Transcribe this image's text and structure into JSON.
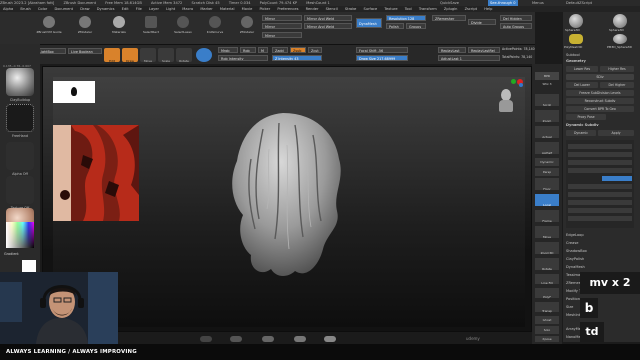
{
  "titlebar": {
    "items": [
      "ZBrush 2023.2 [Abraham fatt]",
      "ZBrush Document",
      "Free Mem 18.614GB",
      "Active Mem 3472",
      "Scratch Disk 45",
      "Timer 0.034",
      "PolyCount 79.474 KP",
      "MeshCount 1"
    ],
    "quicksave": "QuickSave",
    "seethrough": "See-through 0",
    "menus_label": "Menus",
    "script": "DefaultZScript"
  },
  "menubar": {
    "items": [
      "Alpha",
      "Brush",
      "Color",
      "Document",
      "Draw",
      "Dynamics",
      "Edit",
      "File",
      "Layer",
      "Light",
      "Macro",
      "Marker",
      "Material",
      "Movie",
      "Picker",
      "Preferences",
      "Render",
      "Stencil",
      "Stroke",
      "Surface",
      "Texture",
      "Tool",
      "Transform",
      "Zplugin",
      "Zscript",
      "Help"
    ]
  },
  "shelf": {
    "buttons": [
      "ZBrushVM Guide",
      "ZModeler",
      "Materials",
      "SelectRect",
      "SelectLasso",
      "KnifeCurve",
      "ZModeler"
    ],
    "mirror_label": "Mirror",
    "mirror_weld_label": "Mirror And Weld",
    "dynamesh_label": "DynaMesh",
    "resolution_label": "Resolution 128",
    "polish_label": "Polish",
    "groups_label": "Groups",
    "zremesh_label": "ZRemesher",
    "divide_label": "Divide",
    "del_hidden_label": "Del Hidden",
    "auto_groups_label": "Auto Groups",
    "edit_label": "Edit",
    "draw_label": "Draw",
    "move_label": "Move",
    "scale_label": "Scale",
    "rotate_label": "Rotate",
    "mrgb_label": "Mrgb",
    "rgb_label": "Rgb",
    "m_label": "M",
    "zadd_label": "Zadd",
    "zsub_label": "Zsub",
    "zcut_label": "Zcut",
    "focal_label": "Focal Shift -56",
    "draw_size_label": "Draw Size 217.68999",
    "z_intensity_label": "Z Intensity 43",
    "rgb_intensity_label": "Rgb Intensity",
    "replay_last": "ReplayLast",
    "replay_last_rel": "ReplayLastRel",
    "active_points": "ActivePoints: 78,140",
    "total_points": "TotalPoints: 78,140",
    "adjust_last": "AdjustLast 1",
    "left_buttons": [
      "Home Page",
      "LightBox",
      "Live Boolean"
    ]
  },
  "left_panel": {
    "brush_label": "ClayBuildup",
    "stroke_label": "FreeHand",
    "alpha_label": "Alpha Off",
    "texture_label": "Texture Off",
    "material_label": "SkinSphMaterial",
    "gradient_label": "Gradient",
    "coords_label": "0.135,-0.76,-0.607"
  },
  "right_strip": {
    "items": [
      "BPR",
      "SPix 3",
      "Scroll",
      "Zoom",
      "Actual",
      "AAHalf",
      "Dynamic",
      "Persp",
      "Floor",
      "Local",
      "Frame",
      "Move",
      "Zoom3D",
      "Rotate",
      "Line Fill",
      "PolyF",
      "Transp",
      "Ghost",
      "Solo",
      "Xpose"
    ]
  },
  "right_panel": {
    "tool_thumbs": [
      "Sphere3D",
      "PolyMesh3D",
      "Sphere3D",
      "PM3D_Sphere3D"
    ],
    "subtool_label": "Subtool",
    "geometry_label": "Geometry",
    "lower_res": "Lower Res",
    "higher_res": "Higher Res",
    "sdiv_label": "SDiv",
    "del_lower": "Del Lower",
    "del_higher": "Del Higher",
    "freeze_label": "Freeze SubDivision Levels",
    "reconstruct": "Reconstruct Subdiv",
    "convert_bpr": "Convert BPR To Geo",
    "proxy_pose": "Proxy Pose",
    "dynamic_subdiv": "Dynamic Subdiv",
    "dynamic_label": "Dynamic",
    "apply_label": "Apply",
    "items": [
      "EdgeLoop",
      "Crease",
      "ShadowBox",
      "ClayPolish",
      "DynaMesh",
      "Tessimate",
      "ZRemesher",
      "Modify Topology",
      "Position",
      "Size",
      "MeshIntegrity",
      "ArrayMesh",
      "NanoMesh"
    ]
  },
  "overlay": {
    "shortcut_text": "mv  x 2",
    "key_b": "b",
    "key_td": "td",
    "watermark": "udemy"
  },
  "banner": {
    "text": "ALWAYS LEARNING  /  ALWAYS IMPROVING"
  }
}
